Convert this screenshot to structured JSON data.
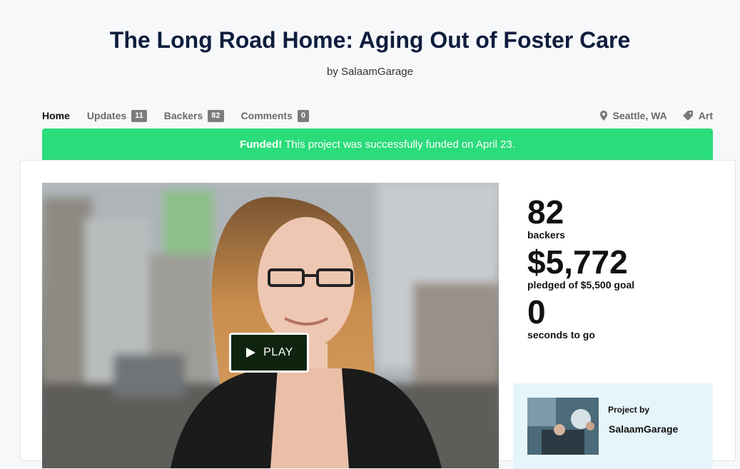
{
  "header": {
    "title": "The Long Road Home: Aging Out of Foster Care",
    "by_label": "by",
    "creator": "SalaamGarage"
  },
  "tabs": [
    {
      "label": "Home",
      "active": true
    },
    {
      "label": "Updates",
      "count": "11"
    },
    {
      "label": "Backers",
      "count": "82"
    },
    {
      "label": "Comments",
      "count": "0"
    }
  ],
  "meta": {
    "location": "Seattle, WA",
    "category": "Art",
    "location_icon": "map-pin-icon",
    "category_icon": "tag-icon"
  },
  "banner": {
    "strong": "Funded!",
    "text": "This project was successfully funded on April 23.",
    "color": "#2bdc7a"
  },
  "video": {
    "play_label": "PLAY"
  },
  "stats": {
    "backers_value": "82",
    "backers_label": "backers",
    "pledged_value": "$5,772",
    "pledged_label": "pledged of $5,500 goal",
    "time_value": "0",
    "time_label": "seconds to go"
  },
  "creator_box": {
    "project_by": "Project by",
    "name": "SalaamGarage"
  }
}
